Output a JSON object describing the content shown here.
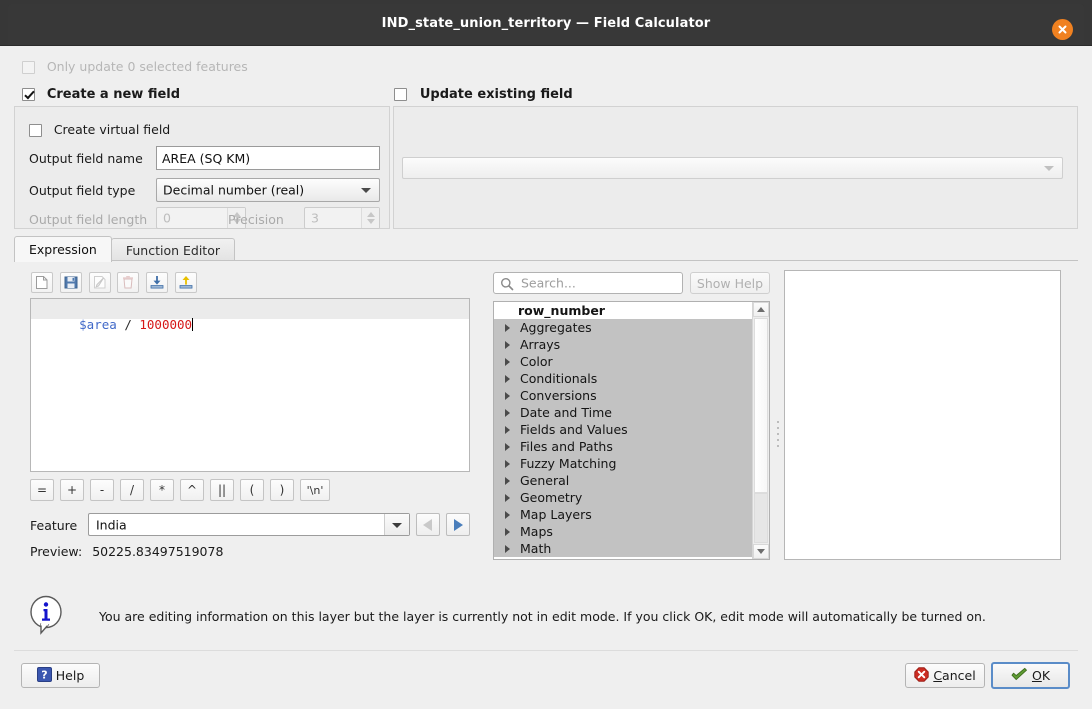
{
  "window": {
    "title": "IND_state_union_territory — Field Calculator",
    "close_icon": "close-x-icon",
    "accent_close": "#f08120"
  },
  "top": {
    "only_update_label": "Only update 0 selected features",
    "only_update_checked": false,
    "create_new_label": "Create a new field",
    "create_new_checked": true,
    "virtual_label": "Create virtual field",
    "virtual_checked": false,
    "output_name_label": "Output field name",
    "output_name_value": "AREA (SQ KM)",
    "output_type_label": "Output field type",
    "output_type_value": "Decimal number (real)",
    "output_length_label": "Output field length",
    "output_length_value": "0",
    "precision_label": "Precision",
    "precision_value": "3",
    "update_existing_label": "Update existing field",
    "update_existing_checked": false,
    "update_existing_value": ""
  },
  "tabs": [
    {
      "label": "Expression",
      "active": true
    },
    {
      "label": "Function Editor",
      "active": false
    }
  ],
  "expr_toolbar": [
    {
      "name": "new-expression-icon",
      "title": "New"
    },
    {
      "name": "save-expression-icon",
      "title": "Save"
    },
    {
      "name": "edit-expression-icon",
      "title": "Edit"
    },
    {
      "name": "delete-expression-icon",
      "title": "Delete"
    },
    {
      "name": "import-expressions-icon",
      "title": "Import"
    },
    {
      "name": "export-expressions-icon",
      "title": "Export"
    }
  ],
  "expression": {
    "tokens": [
      {
        "text": "$area",
        "type": "var"
      },
      {
        "text": " / ",
        "type": "op"
      },
      {
        "text": "1000000",
        "type": "num"
      }
    ],
    "plain": "$area / 1000000",
    "colors": {
      "var": "#4169c8",
      "number": "#d61818",
      "operator": "#2a2a2a"
    }
  },
  "operators": [
    "=",
    "+",
    "-",
    "/",
    "*",
    "^",
    "||",
    "(",
    ")",
    "'\\n'"
  ],
  "feature": {
    "label": "Feature",
    "value": "India",
    "prev_icon": "previous-feature-icon",
    "next_icon": "next-feature-icon"
  },
  "preview": {
    "label": "Preview:",
    "value": "50225.83497519078"
  },
  "search": {
    "placeholder": "Search...",
    "value": "",
    "icon": "search-icon"
  },
  "show_help_button": "Show Help",
  "function_list": [
    {
      "label": "row_number",
      "expandable": false,
      "header": true
    },
    {
      "label": "Aggregates",
      "expandable": true
    },
    {
      "label": "Arrays",
      "expandable": true
    },
    {
      "label": "Color",
      "expandable": true
    },
    {
      "label": "Conditionals",
      "expandable": true
    },
    {
      "label": "Conversions",
      "expandable": true
    },
    {
      "label": "Date and Time",
      "expandable": true
    },
    {
      "label": "Fields and Values",
      "expandable": true
    },
    {
      "label": "Files and Paths",
      "expandable": true
    },
    {
      "label": "Fuzzy Matching",
      "expandable": true
    },
    {
      "label": "General",
      "expandable": true
    },
    {
      "label": "Geometry",
      "expandable": true
    },
    {
      "label": "Map Layers",
      "expandable": true
    },
    {
      "label": "Maps",
      "expandable": true
    },
    {
      "label": "Math",
      "expandable": true
    }
  ],
  "help_panel": {
    "content": ""
  },
  "info": {
    "icon": "info-icon",
    "message": "You are editing information on this layer but the layer is currently not in edit mode. If you click OK, edit mode will automatically be turned on."
  },
  "buttons": {
    "help": {
      "label": "Help",
      "icon": "help-question-icon"
    },
    "cancel": {
      "label": "Cancel",
      "accel": "C",
      "icon": "cancel-x-icon"
    },
    "ok": {
      "label": "OK",
      "accel": "O",
      "icon": "ok-check-icon",
      "focused": true
    }
  }
}
